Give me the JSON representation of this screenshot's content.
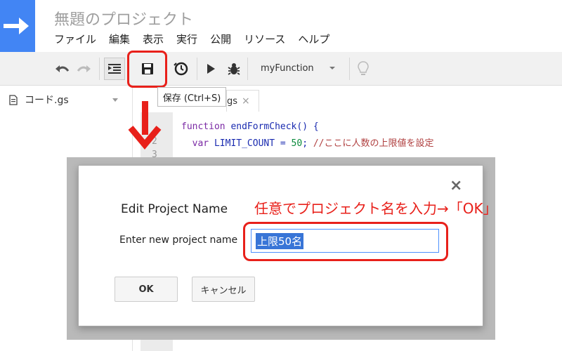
{
  "app": {
    "project_title": "無題のプロジェクト",
    "menu": [
      "ファイル",
      "編集",
      "表示",
      "実行",
      "公開",
      "リソース",
      "ヘルプ"
    ]
  },
  "toolbar": {
    "function_select": "myFunction",
    "save_tooltip": "保存 (Ctrl+S)"
  },
  "sidebar": {
    "file_name": "コード.gs"
  },
  "editor": {
    "tab_label": "gs",
    "tab_close": "×",
    "line_numbers": [
      "2",
      "3"
    ],
    "code_line1_kw": "function",
    "code_line1_rest": " endFormCheck() {",
    "code_line2_kw": "var",
    "code_line2_var": " LIMIT_COUNT = ",
    "code_line2_num": "50",
    "code_line2_semi": "; ",
    "code_line2_comment": "//ここに人数の上限値を設定"
  },
  "dialog": {
    "title": "Edit Project Name",
    "close": "×",
    "label": "Enter new project name",
    "input_value": "上限50名",
    "ok_label": "OK",
    "cancel_label": "キャンセル"
  },
  "annotation": {
    "text": "任意でプロジェクト名を入力→「OK」"
  },
  "colors": {
    "logo_blue": "#4285f4",
    "highlight_red": "#e8201a",
    "selection_blue": "#3875d7"
  }
}
